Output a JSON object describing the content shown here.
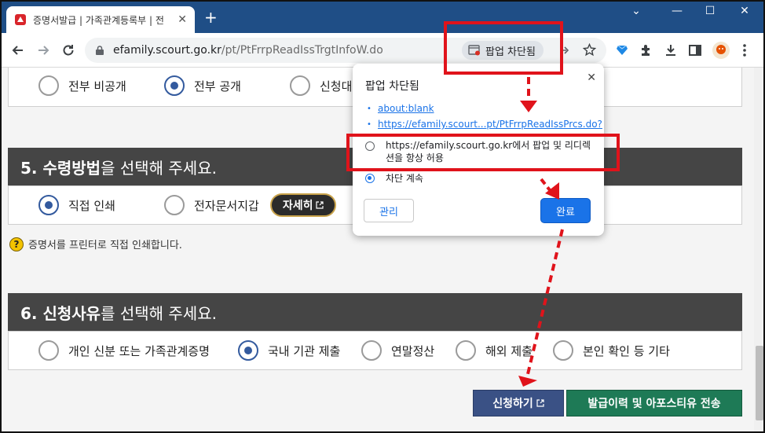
{
  "browser": {
    "tab_title": "증명서발급 | 가족관계등록부 | 전",
    "url_host": "efamily.scourt.go.kr",
    "url_path": "/pt/PtFrrpReadIssTrgtInfoW.do",
    "popup_chip_label": "팝업 차단됨"
  },
  "sections": {
    "disclosure": {
      "options": [
        {
          "label": "전부 비공개",
          "checked": false
        },
        {
          "label": "전부 공개",
          "checked": true
        },
        {
          "label": "신청대",
          "checked": false
        }
      ]
    },
    "receive": {
      "header_bold": "5. 수령방법",
      "header_rest": "을 선택해 주세요.",
      "options": [
        {
          "label": "직접 인쇄",
          "checked": true
        },
        {
          "label": "전자문서지갑",
          "checked": false
        }
      ],
      "detail_button": "자세히",
      "note": "증명서를 프린터로 직접 인쇄합니다."
    },
    "reason": {
      "header_bold": "6. 신청사유",
      "header_rest": "를 선택해 주세요.",
      "options": [
        {
          "label": "개인 신분 또는 가족관계증명",
          "checked": false
        },
        {
          "label": "국내 기관 제출",
          "checked": true
        },
        {
          "label": "연말정산",
          "checked": false
        },
        {
          "label": "해외 제출",
          "checked": false
        },
        {
          "label": "본인 확인 등 기타",
          "checked": false
        }
      ]
    }
  },
  "actions": {
    "apply_button": "신청하기",
    "history_button": "발급이력 및 아포스티유 전송"
  },
  "popup_bubble": {
    "title": "팝업 차단됨",
    "links": [
      "about:blank",
      "https://efamily.scourt...pt/PtFrrpReadIssPrcs.do?"
    ],
    "option_allow_line1": "https://efamily.scourt.go.kr에서 팝업 및 리디렉",
    "option_allow_line2": "션을 항상 허용",
    "option_block": "차단 계속",
    "allow_checked": false,
    "block_checked": true,
    "manage_button": "관리",
    "done_button": "완료"
  },
  "colors": {
    "chrome_blue": "#1f4e86",
    "section_header": "#454545",
    "radio_checked": "#335a9e",
    "apply_button": "#3a5185",
    "history_button": "#1e7a56",
    "annotation_red": "#e0131b",
    "link_blue": "#1a73e8"
  },
  "icons": [
    "back-arrow-icon",
    "forward-arrow-icon",
    "reload-icon",
    "lock-icon",
    "popup-blocked-icon",
    "share-icon",
    "star-icon",
    "extension-gem-icon",
    "puzzle-icon",
    "download-icon",
    "sidepanel-icon",
    "profile-avatar-icon",
    "kebab-menu-icon",
    "external-link-icon",
    "question-icon",
    "close-icon"
  ]
}
